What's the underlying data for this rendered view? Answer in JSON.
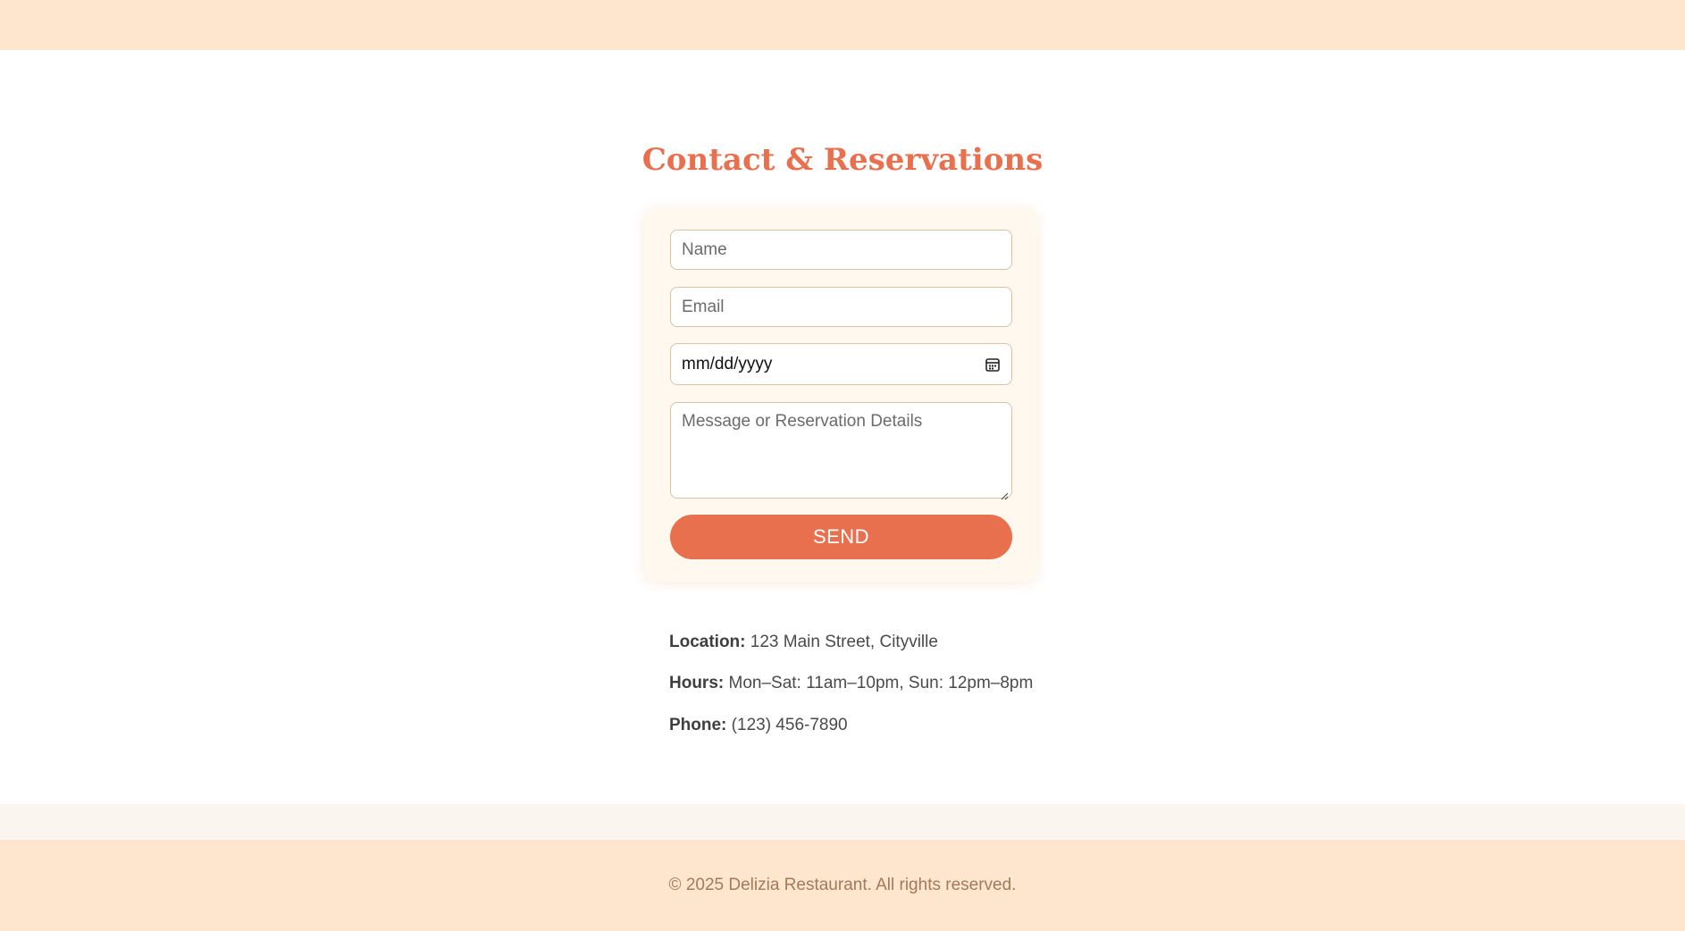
{
  "section": {
    "title": "Contact & Reservations"
  },
  "form": {
    "name_placeholder": "Name",
    "email_placeholder": "Email",
    "date_placeholder": "mm/dd/yyyy",
    "message_placeholder": "Message or Reservation Details",
    "send_label": "SEND"
  },
  "info": {
    "location_label": "Location:",
    "location_value": "123 Main Street, Cityville",
    "hours_label": "Hours:",
    "hours_value": "Mon–Sat: 11am–10pm, Sun: 12pm–8pm",
    "phone_label": "Phone:",
    "phone_value": "(123) 456-7890"
  },
  "footer": {
    "copyright": "© 2025 Delizia Restaurant. All rights reserved."
  },
  "colors": {
    "accent": "#e8704f",
    "header_bg": "#fde6cd",
    "card_bg": "#fff8ef"
  },
  "icons": {
    "date_picker": "calendar-icon",
    "textarea_resize": "resize-grip-icon"
  }
}
